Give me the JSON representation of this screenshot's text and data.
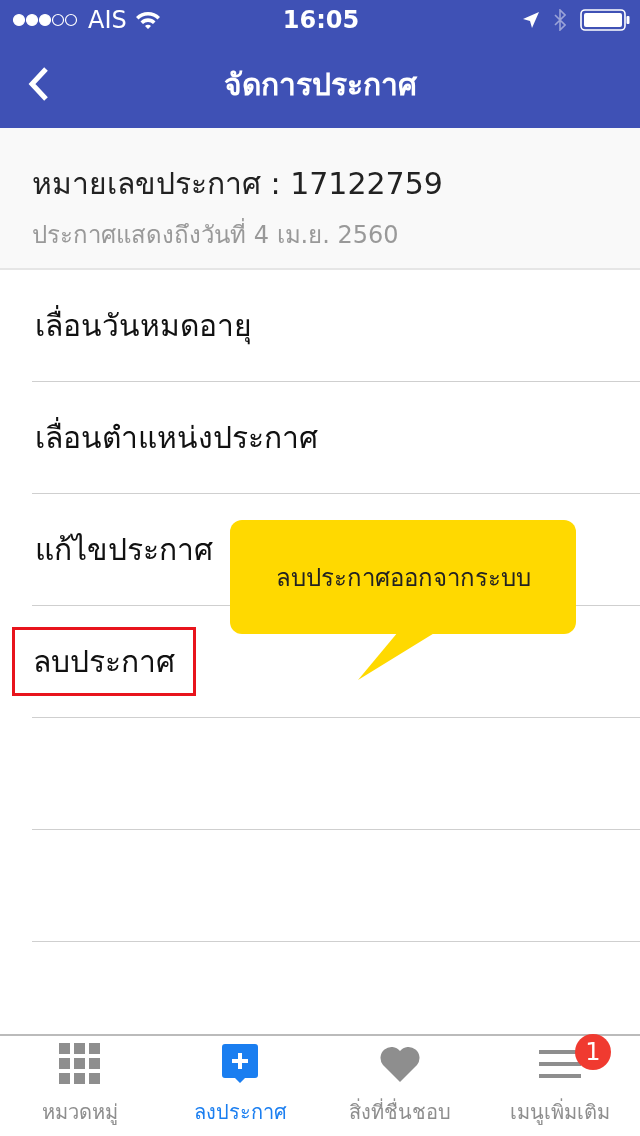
{
  "status_bar": {
    "carrier": "AIS",
    "time": "16:05"
  },
  "nav_bar": {
    "title": "จัดการประกาศ"
  },
  "header": {
    "title": "หมายเลขประกาศ : 17122759",
    "subtitle": "ประกาศแสดงถึงวันที่ 4 เม.ย. 2560"
  },
  "menu_items": [
    {
      "label": "เลื่อนวันหมดอายุ",
      "highlighted": false
    },
    {
      "label": "เลื่อนตำแหน่งประกาศ",
      "highlighted": false
    },
    {
      "label": "แก้ไขประกาศ",
      "highlighted": false
    },
    {
      "label": "ลบประกาศ",
      "highlighted": true
    }
  ],
  "callout": {
    "text": "ลบประกาศออกจากระบบ"
  },
  "tab_bar": [
    {
      "kind": "grid",
      "label": "หมวดหมู่",
      "selected": false
    },
    {
      "kind": "post",
      "label": "ลงประกาศ",
      "selected": true
    },
    {
      "kind": "heart",
      "label": "สิ่งที่ชื่นชอบ",
      "selected": false
    },
    {
      "kind": "menu",
      "label": "เมนูเพิ่มเติม",
      "selected": false,
      "badge": "1"
    }
  ]
}
